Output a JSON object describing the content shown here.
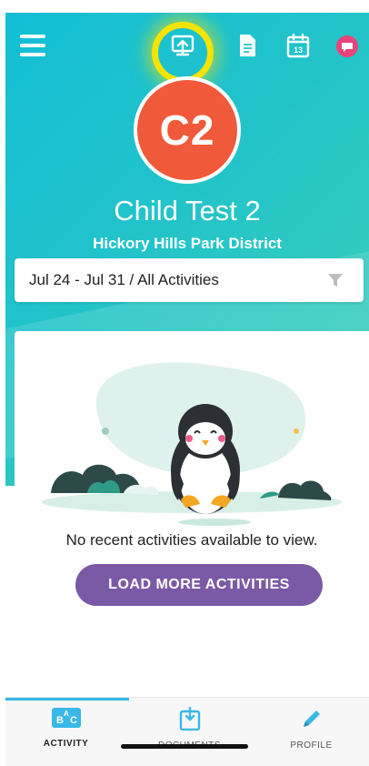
{
  "colors": {
    "hero_gradient_start": "#13bfd6",
    "hero_gradient_end": "#3fd0b4",
    "avatar_bg": "#f05a3a",
    "primary_button": "#7a59a6",
    "tab_active": "#38b8e6",
    "highlight_ring": "#f5e300",
    "chat_icon": "#e9437a"
  },
  "topbar": {
    "icons": [
      "menu-icon",
      "check-in-icon",
      "document-icon",
      "calendar-icon",
      "chat-icon"
    ],
    "calendar_day": "13"
  },
  "profile": {
    "avatar_initials": "C2",
    "child_name": "Child Test 2",
    "organization": "Hickory Hills Park District"
  },
  "filter": {
    "label": "Jul 24 - Jul 31 / All Activities",
    "icon": "filter-icon"
  },
  "feed": {
    "empty_message": "No recent activities available to view.",
    "load_more_label": "LOAD MORE ACTIVITIES"
  },
  "tabbar": {
    "tabs": [
      {
        "label": "ACTIVITY",
        "icon": "activity-icon",
        "active": true
      },
      {
        "label": "DOCUMENTS",
        "icon": "documents-icon",
        "active": false
      },
      {
        "label": "PROFILE",
        "icon": "profile-icon",
        "active": false
      }
    ]
  }
}
